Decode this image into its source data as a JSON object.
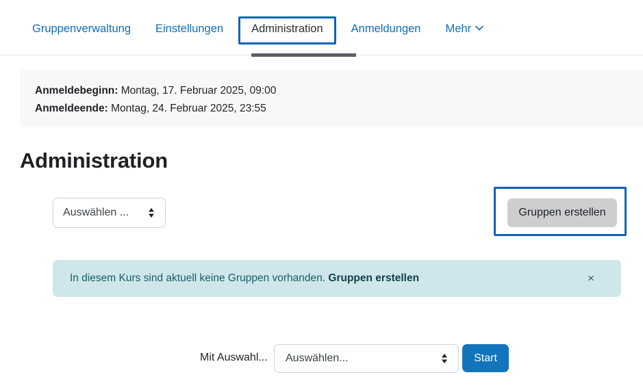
{
  "nav": {
    "tabs": [
      {
        "label": "Gruppenverwaltung",
        "active": false
      },
      {
        "label": "Einstellungen",
        "active": false
      },
      {
        "label": "Administration",
        "active": true
      },
      {
        "label": "Anmeldungen",
        "active": false
      },
      {
        "label": "Mehr",
        "active": false,
        "icon": "chevron-down-icon"
      }
    ]
  },
  "info": {
    "start_label": "Anmeldebeginn:",
    "start_value": "Montag, 17. Februar 2025, 09:00",
    "end_label": "Anmeldeende:",
    "end_value": "Montag, 24. Februar 2025, 23:55"
  },
  "page": {
    "title": "Administration"
  },
  "actions": {
    "select_value": "Auswählen ...",
    "create_groups_label": "Gruppen erstellen"
  },
  "alert": {
    "message": "In diesem Kurs sind aktuell keine Gruppen vorhanden.",
    "link_label": "Gruppen erstellen",
    "close_label": "×"
  },
  "bulk": {
    "label": "Mit Auswahl...",
    "select_value": "Auswählen...",
    "start_label": "Start"
  },
  "colors": {
    "link_blue": "#0f6cbf",
    "focus_blue": "#0b63ba",
    "primary_button": "#1275bc",
    "alert_bg": "#cfe7ea",
    "alert_text": "#175c6b",
    "info_bg": "#f7f8f9",
    "secondary_button": "#ccced0",
    "active_underline": "#5d6165"
  }
}
